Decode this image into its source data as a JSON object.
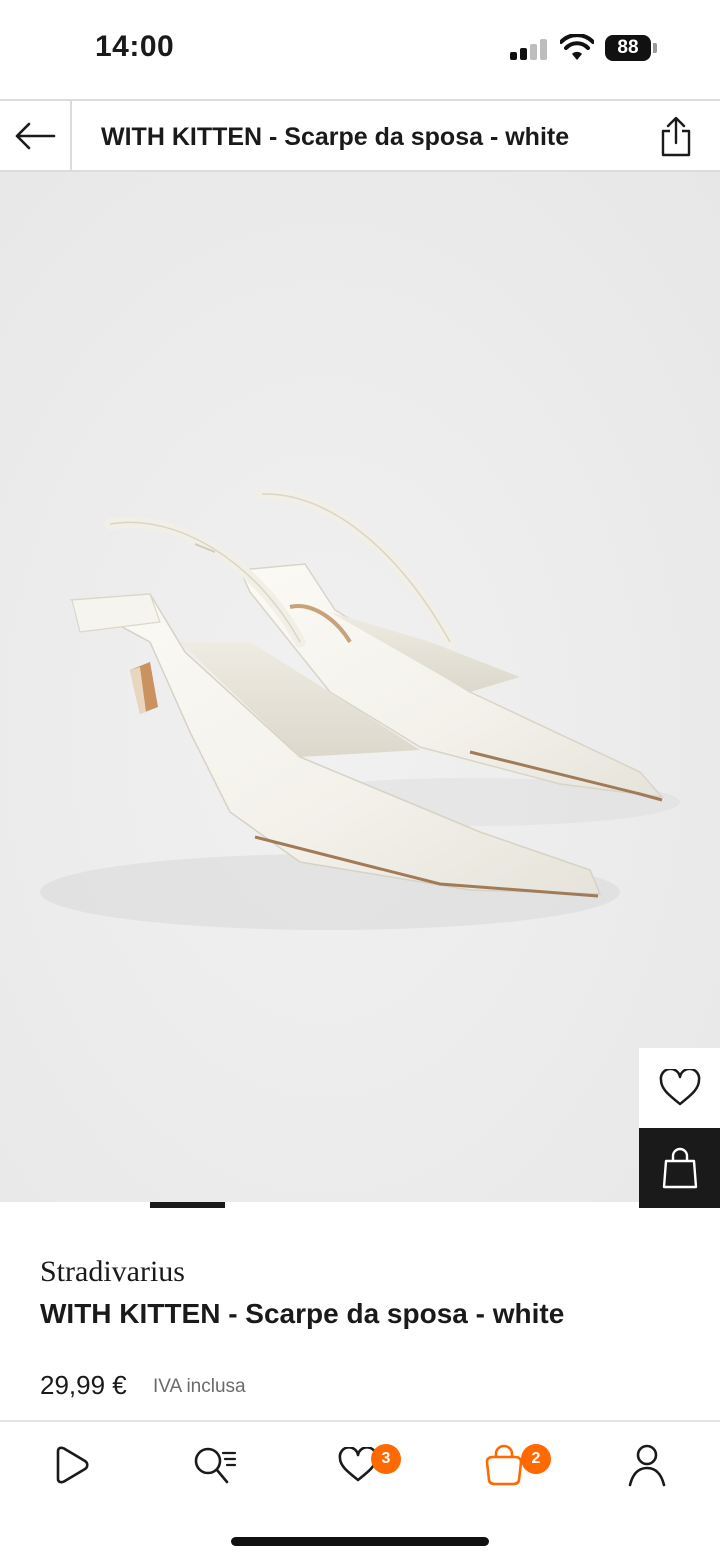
{
  "status_bar": {
    "time": "14:00",
    "battery": "88",
    "icons": [
      "signal-icon",
      "wifi-icon",
      "battery-icon"
    ]
  },
  "header": {
    "title": "WITH KITTEN - Scarpe da sposa - white",
    "icons": [
      "back-arrow-icon",
      "share-icon"
    ]
  },
  "gallery": {
    "image_subject": "white pointed slingback kitten heels",
    "image_count_visible": 1,
    "active_index": 0,
    "icons": [
      "heart-icon",
      "shopping-bag-icon"
    ]
  },
  "product": {
    "brand": "Stradivarius",
    "name": "WITH KITTEN - Scarpe da sposa - white",
    "price": "29,99 €",
    "vat_note": "IVA inclusa"
  },
  "bottom_nav": {
    "items": [
      {
        "icon": "home-play-icon"
      },
      {
        "icon": "search-icon"
      },
      {
        "icon": "wishlist-icon",
        "badge": "3"
      },
      {
        "icon": "bag-icon",
        "badge": "2",
        "active": true
      },
      {
        "icon": "profile-icon"
      }
    ]
  },
  "colors": {
    "accent": "#ff6900",
    "dark": "#1a1a1a",
    "image_bg": "#ececec"
  }
}
